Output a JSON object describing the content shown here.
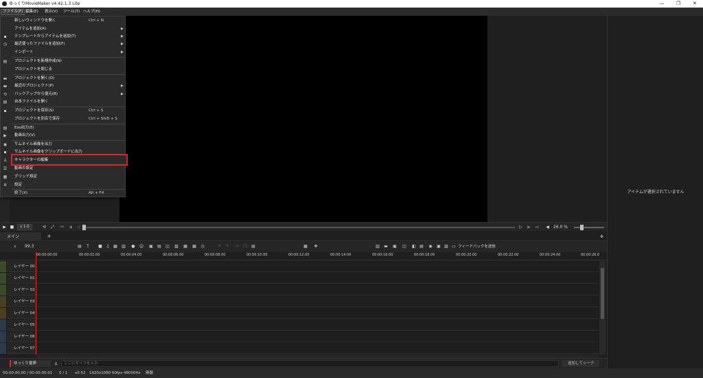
{
  "window": {
    "title": "ゆっくりMovieMaker v4.42.1.3 Lite"
  },
  "window_controls": [
    "—",
    "❐",
    "✕"
  ],
  "menubar": [
    {
      "label": "ファイル(F)",
      "active": true
    },
    {
      "label": "編集(E)"
    },
    {
      "label": "表示(V)"
    },
    {
      "label": "ツール(T)"
    },
    {
      "label": "ヘルプ(H)"
    }
  ],
  "file_menu": [
    {
      "label": "新しいウィンドウを開く",
      "shortcut": "Ctrl + N",
      "icon": ""
    },
    {
      "label": "アイテムを追加(A)",
      "submenu": true
    },
    {
      "label": "テンプレートからアイテムを追加(T)",
      "submenu": true,
      "icon": "save-icon"
    },
    {
      "label": "最近使ったファイルを追加(F)",
      "submenu": true,
      "icon": "clock-icon"
    },
    {
      "label": "インポート",
      "submenu": true
    },
    {
      "label": "プロジェクトを新規作成(N)",
      "icon": "new-file-icon"
    },
    {
      "label": "プロジェクトを閉じる"
    },
    {
      "label": "プロジェクトを開く(O)",
      "icon": "folder-icon"
    },
    {
      "label": "最近のプロジェクト(P)",
      "submenu": true,
      "icon": "recent-folder-icon"
    },
    {
      "label": "バックアップから復元(B)",
      "submenu": true,
      "icon": "restore-icon"
    },
    {
      "label": "台本ファイルを開く",
      "icon": "script-icon"
    },
    {
      "label": "プロジェクトを保存(S)",
      "shortcut": "Ctrl + S",
      "icon": "save-icon"
    },
    {
      "label": "プロジェクトを別名で保存",
      "shortcut": "Ctrl + Shift + S"
    },
    {
      "label": "Exo出力(E)",
      "icon": "export-icon"
    },
    {
      "label": "動画出力(V)",
      "icon": "video-icon"
    },
    {
      "label": "サムネイル画像を出力",
      "icon": "camera-icon"
    },
    {
      "label": "サムネイル画像をクリップボードに出力",
      "icon": "clipboard-icon"
    },
    {
      "label": "キャラクターの編集",
      "icon": "character-icon",
      "highlighted": true
    },
    {
      "label": "動画の設定",
      "icon": "sliders-icon"
    },
    {
      "label": "グリッド設定",
      "icon": "grid-icon"
    },
    {
      "label": "設定",
      "icon": "gear-icon"
    },
    {
      "label": "終了(X)",
      "shortcut": "Alt + F4"
    }
  ],
  "playback": {
    "speed": "x 1.0",
    "volume": "26.0 %"
  },
  "right_panel": {
    "message": "アイテムが選択されていません"
  },
  "timeline": {
    "tabs": [
      "メイン"
    ],
    "add_tab": "+",
    "zoom": "99.3",
    "feedback_label": "フィードバックを送信",
    "ruler_ticks": [
      "00:00:00.00",
      "00:00:02.00",
      "00:00:04.00",
      "00:00:06.00",
      "00:00:08.00",
      "00:00:10.00",
      "00:00:12.00",
      "00:00:14.00",
      "00:00:16.00",
      "00:00:18.00",
      "00:00:20.00",
      "00:00:22.00",
      "00:00:24.00",
      "00:00:26.0"
    ],
    "layers": [
      "レイヤー 00",
      "レイヤー 01",
      "レイヤー 02",
      "レイヤー 03",
      "レイヤー 04",
      "レイヤー 05",
      "レイヤー 06",
      "レイヤー 07"
    ]
  },
  "serif": {
    "character": "ゆっくり霊夢",
    "placeholder": "ここにセリフを入力",
    "add_seek": "追加してシーク"
  },
  "status": {
    "time": "00:00:00.00 / 00:00:00.01",
    "frame": "0 / 1",
    "zoom": "x0.52",
    "format": "1920x1080 60fps 48000Hz",
    "project": "無題"
  }
}
